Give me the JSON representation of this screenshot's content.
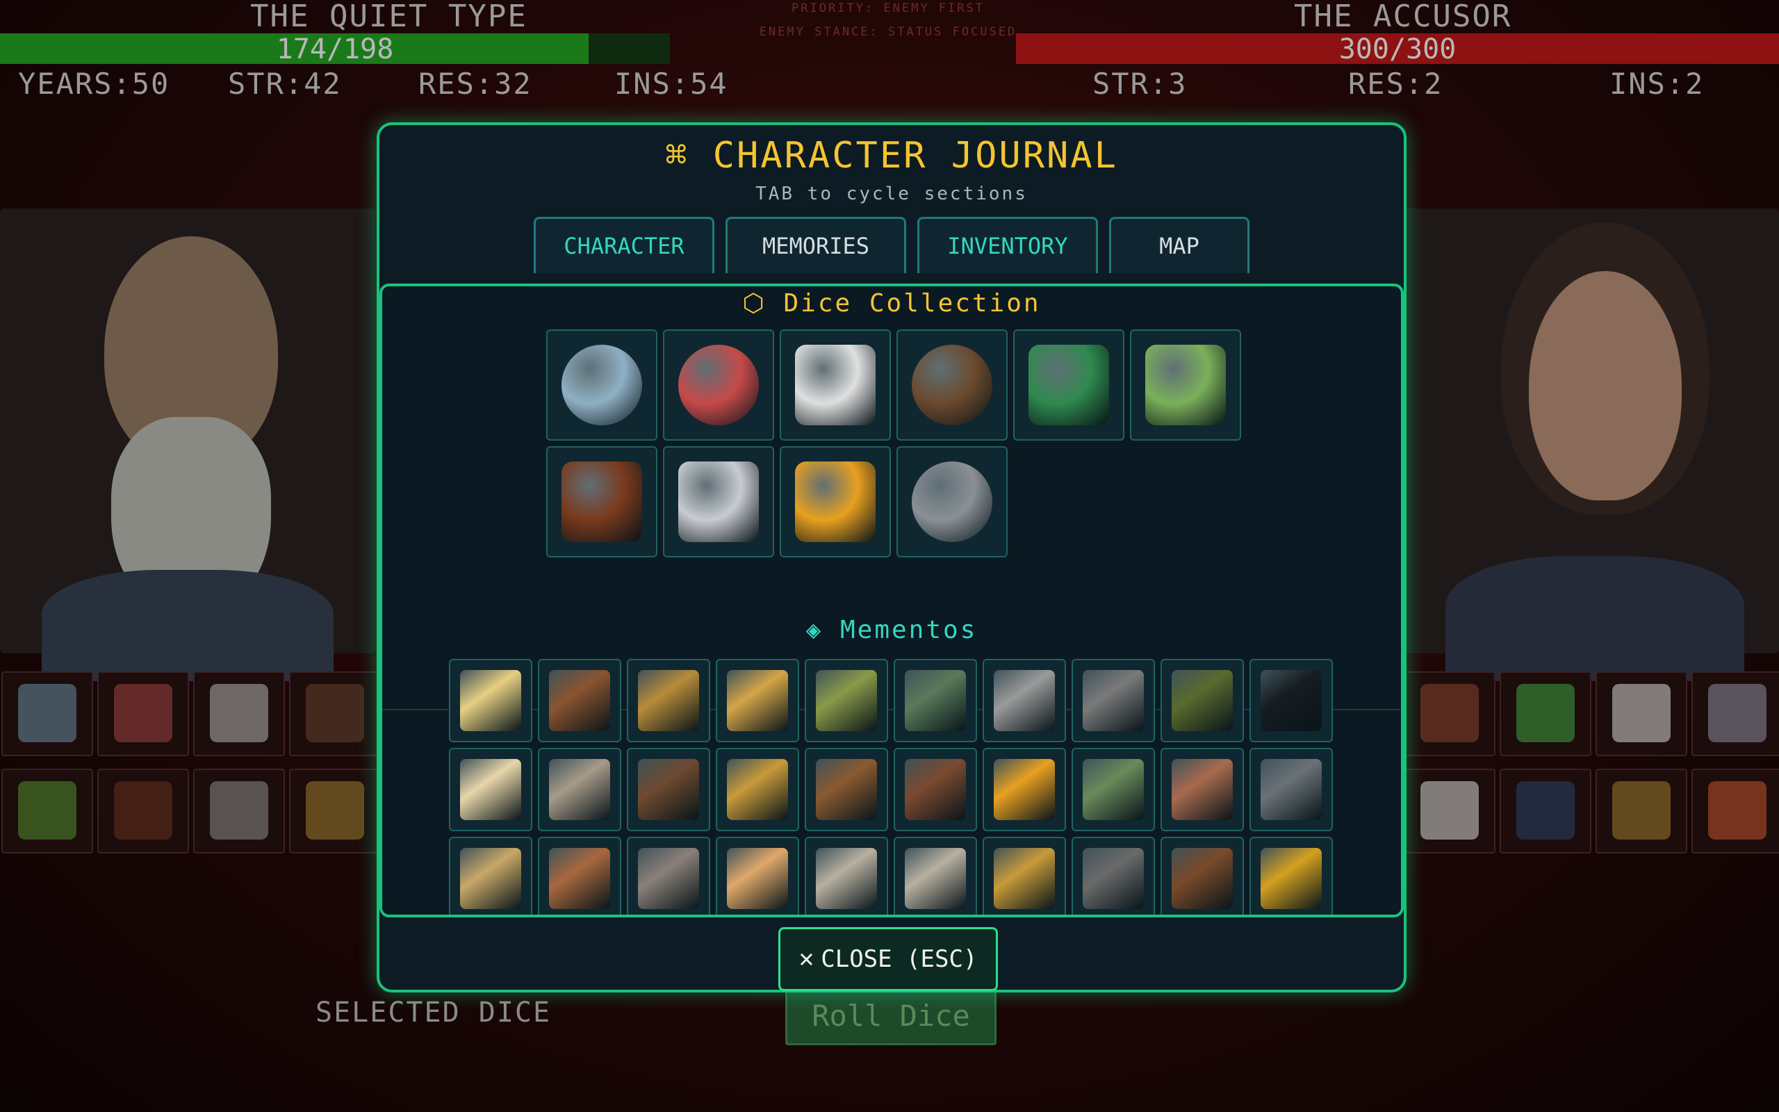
{
  "player": {
    "name": "THE QUIET TYPE",
    "hp_text": "174/198",
    "hp_fraction": 0.879,
    "stats": [
      "YEARS:50",
      "STR:42",
      "RES:32",
      "INS:54"
    ],
    "bar_color": "#1a7a1a"
  },
  "enemy": {
    "name": "THE ACCUSOR",
    "hp_text": "300/300",
    "hp_fraction": 1.0,
    "stats": [
      "STR:3",
      "RES:2",
      "INS:2"
    ],
    "bar_color": "#8e1212"
  },
  "center_info": {
    "priority": "PRIORITY: ENEMY FIRST",
    "stance": "ENEMY STANCE: STATUS FOCUSED"
  },
  "bottom": {
    "selected_dice": "SELECTED DICE",
    "roll_dice": "Roll Dice"
  },
  "journal": {
    "icon": "⌘",
    "title": "CHARACTER JOURNAL",
    "subtitle": "TAB to cycle sections",
    "tabs": [
      "CHARACTER",
      "MEMORIES",
      "INVENTORY",
      "MAP"
    ],
    "dice_section": {
      "icon": "⬡",
      "title": "Dice Collection",
      "dice": [
        {
          "icon": "disco-ball-die-icon",
          "color": "#8fb0c4"
        },
        {
          "icon": "rainbow-shield-die-icon",
          "color": "#c64a4a"
        },
        {
          "icon": "winged-white-die-icon",
          "color": "#e0e0e0"
        },
        {
          "icon": "brown-d12-die-icon",
          "color": "#6b4a2e"
        },
        {
          "icon": "green-gold-die-icon",
          "color": "#2f8a4e"
        },
        {
          "icon": "green-gem-die-icon",
          "color": "#7bb05a"
        },
        {
          "icon": "rust-mossy-die-icon",
          "color": "#7a3a1e"
        },
        {
          "icon": "white-die-icon",
          "color": "#c8ccd0"
        },
        {
          "icon": "gold-halo-die-icon",
          "color": "#e8a020"
        },
        {
          "icon": "grey-d20-die-icon",
          "color": "#8a9096"
        }
      ]
    },
    "mementos_section": {
      "icon": "◈",
      "title": "Mementos",
      "items": [
        {
          "icon": "old-photo-icon",
          "color": "#e6cf82"
        },
        {
          "icon": "teddy-bear-icon",
          "color": "#8a5430"
        },
        {
          "icon": "locket-icon",
          "color": "#b88b3a"
        },
        {
          "icon": "pocket-watch-icon",
          "color": "#d4a548"
        },
        {
          "icon": "perfume-bottle-icon",
          "color": "#8a9a48"
        },
        {
          "icon": "pill-bottle-icon",
          "color": "#5a7a5a"
        },
        {
          "icon": "bloody-hammer-icon",
          "color": "#9a9a9a"
        },
        {
          "icon": "cash-box-icon",
          "color": "#7a7a7a"
        },
        {
          "icon": "green-book-icon",
          "color": "#5a6a2e"
        },
        {
          "icon": "shadow-figure-icon",
          "color": "#161c22"
        },
        {
          "icon": "graduation-diploma-icon",
          "color": "#e8d6a8"
        },
        {
          "icon": "flask-icon",
          "color": "#a89a88"
        },
        {
          "icon": "framed-certificate-icon",
          "color": "#6e4a30"
        },
        {
          "icon": "medal-icon",
          "color": "#c89a3a"
        },
        {
          "icon": "fountain-pen-icon",
          "color": "#8a5a30"
        },
        {
          "icon": "note-frame-icon",
          "color": "#7a4a30"
        },
        {
          "icon": "sad-face-icon",
          "color": "#e8a020"
        },
        {
          "icon": "money-stack-icon",
          "color": "#6a8a5a"
        },
        {
          "icon": "wallet-icon",
          "color": "#a86a4e"
        },
        {
          "icon": "radio-icon",
          "color": "#6a7278"
        },
        {
          "icon": "best-dad-plaque-icon",
          "color": "#c8a868"
        },
        {
          "icon": "crib-icon",
          "color": "#a8683e"
        },
        {
          "icon": "flask-label-icon",
          "color": "#8a8078"
        },
        {
          "icon": "envelope-icon",
          "color": "#e0a86a"
        },
        {
          "icon": "ointment-tube-icon",
          "color": "#b8b0a0"
        },
        {
          "icon": "rip-newspaper-icon",
          "color": "#b8b0a0"
        },
        {
          "icon": "wristwatch-icon",
          "color": "#c89a3a"
        },
        {
          "icon": "photo-frame-icon",
          "color": "#6a6a6a"
        },
        {
          "icon": "rocking-chair-icon",
          "color": "#7a4a2a"
        },
        {
          "icon": "gold-ring-icon",
          "color": "#d4a020"
        }
      ]
    },
    "close_label": "CLOSE (ESC)"
  },
  "side_dice_left": [
    "#5a7a8a",
    "#8a3a3a",
    "#9a9a9a",
    "#5a3a2a",
    "#4a7a2a",
    "#5a2a1a",
    "#7a7a7a",
    "#8a6a2a"
  ],
  "side_dice_right": [
    "#7a3a2a",
    "#3a8a3a",
    "#b8b8b8",
    "#7a7a88",
    "#b8b8b8",
    "#2a3a5a",
    "#8a6a2a",
    "#a84a2a"
  ],
  "colors": {
    "accent": "#19c27b",
    "title": "#f4c531",
    "tab_active": "#35d6c0",
    "mementos_title": "#35d6c0"
  }
}
